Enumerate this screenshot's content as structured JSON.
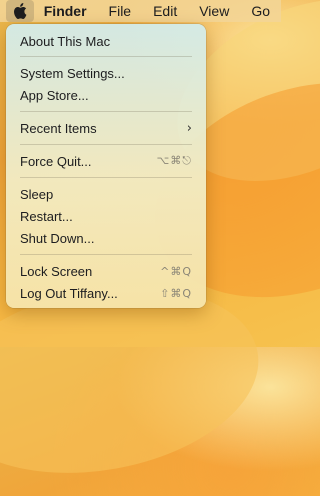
{
  "menubar": {
    "apple_icon": "apple-logo-icon",
    "items": [
      "Finder",
      "File",
      "Edit",
      "View",
      "Go"
    ]
  },
  "apple_menu": {
    "about": "About This Mac",
    "system_settings": "System Settings...",
    "app_store": "App Store...",
    "recent_items": "Recent Items",
    "recent_items_icon": "chevron-right-icon",
    "force_quit": "Force Quit...",
    "force_quit_shortcut": "⌥⌘⎋",
    "sleep": "Sleep",
    "restart": "Restart...",
    "shut_down": "Shut Down...",
    "lock_screen": "Lock Screen",
    "lock_screen_shortcut": "^⌘Q",
    "log_out": "Log Out Tiffany...",
    "log_out_shortcut": "⇧⌘Q"
  },
  "colors": {
    "menubar": "#F2D596",
    "menu_top": "#D2ECEC",
    "menu_bottom": "#F6E4AA",
    "wallpaper": "#F0A53A"
  }
}
